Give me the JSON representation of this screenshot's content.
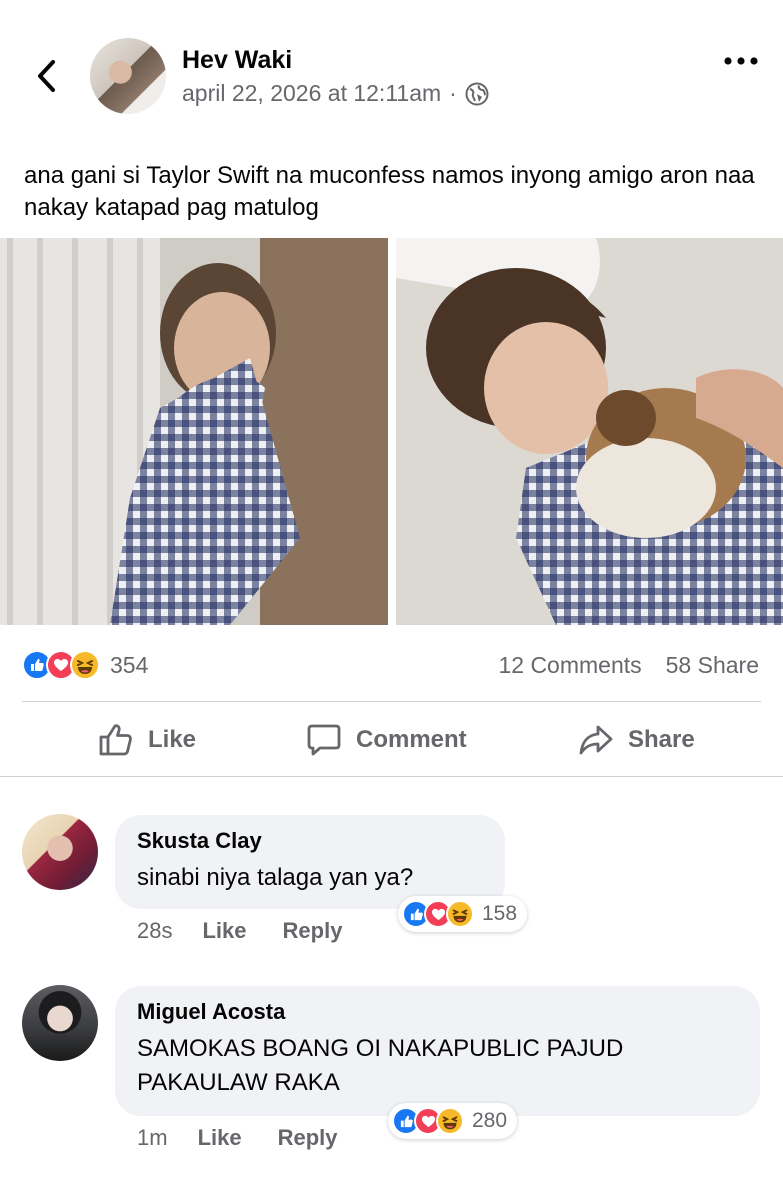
{
  "post": {
    "author": "Hev Waki",
    "timestamp": "april 22, 2026 at 12:11am",
    "separator": "·",
    "audience_icon": "globe-icon",
    "text": "ana gani si Taylor Swift na muconfess namos inyong amigo aron naa nakay katapad pag matulog"
  },
  "reactions_summary": {
    "icons": [
      "like-icon",
      "love-icon",
      "haha-icon"
    ],
    "count": "354",
    "comments": "12 Comments",
    "shares": "58 Share"
  },
  "actions": {
    "like": "Like",
    "comment": "Comment",
    "share": "Share"
  },
  "comments": [
    {
      "name": "Skusta Clay",
      "text": "sinabi niya talaga yan ya?",
      "time": "28s",
      "like": "Like",
      "reply": "Reply",
      "reaction_count": "158"
    },
    {
      "name": "Miguel Acosta",
      "text": "SAMOKAS BOANG OI NAKAPUBLIC PAJUD PAKAULAW RAKA",
      "time": "1m",
      "like": "Like",
      "reply": "Reply",
      "reaction_count": "280"
    }
  ],
  "colors": {
    "accent_blue": "#1877f2",
    "love_red": "#f33e58",
    "haha_yellow": "#f7b928",
    "secondary_text": "#65676b",
    "bubble_bg": "#f0f2f5"
  }
}
